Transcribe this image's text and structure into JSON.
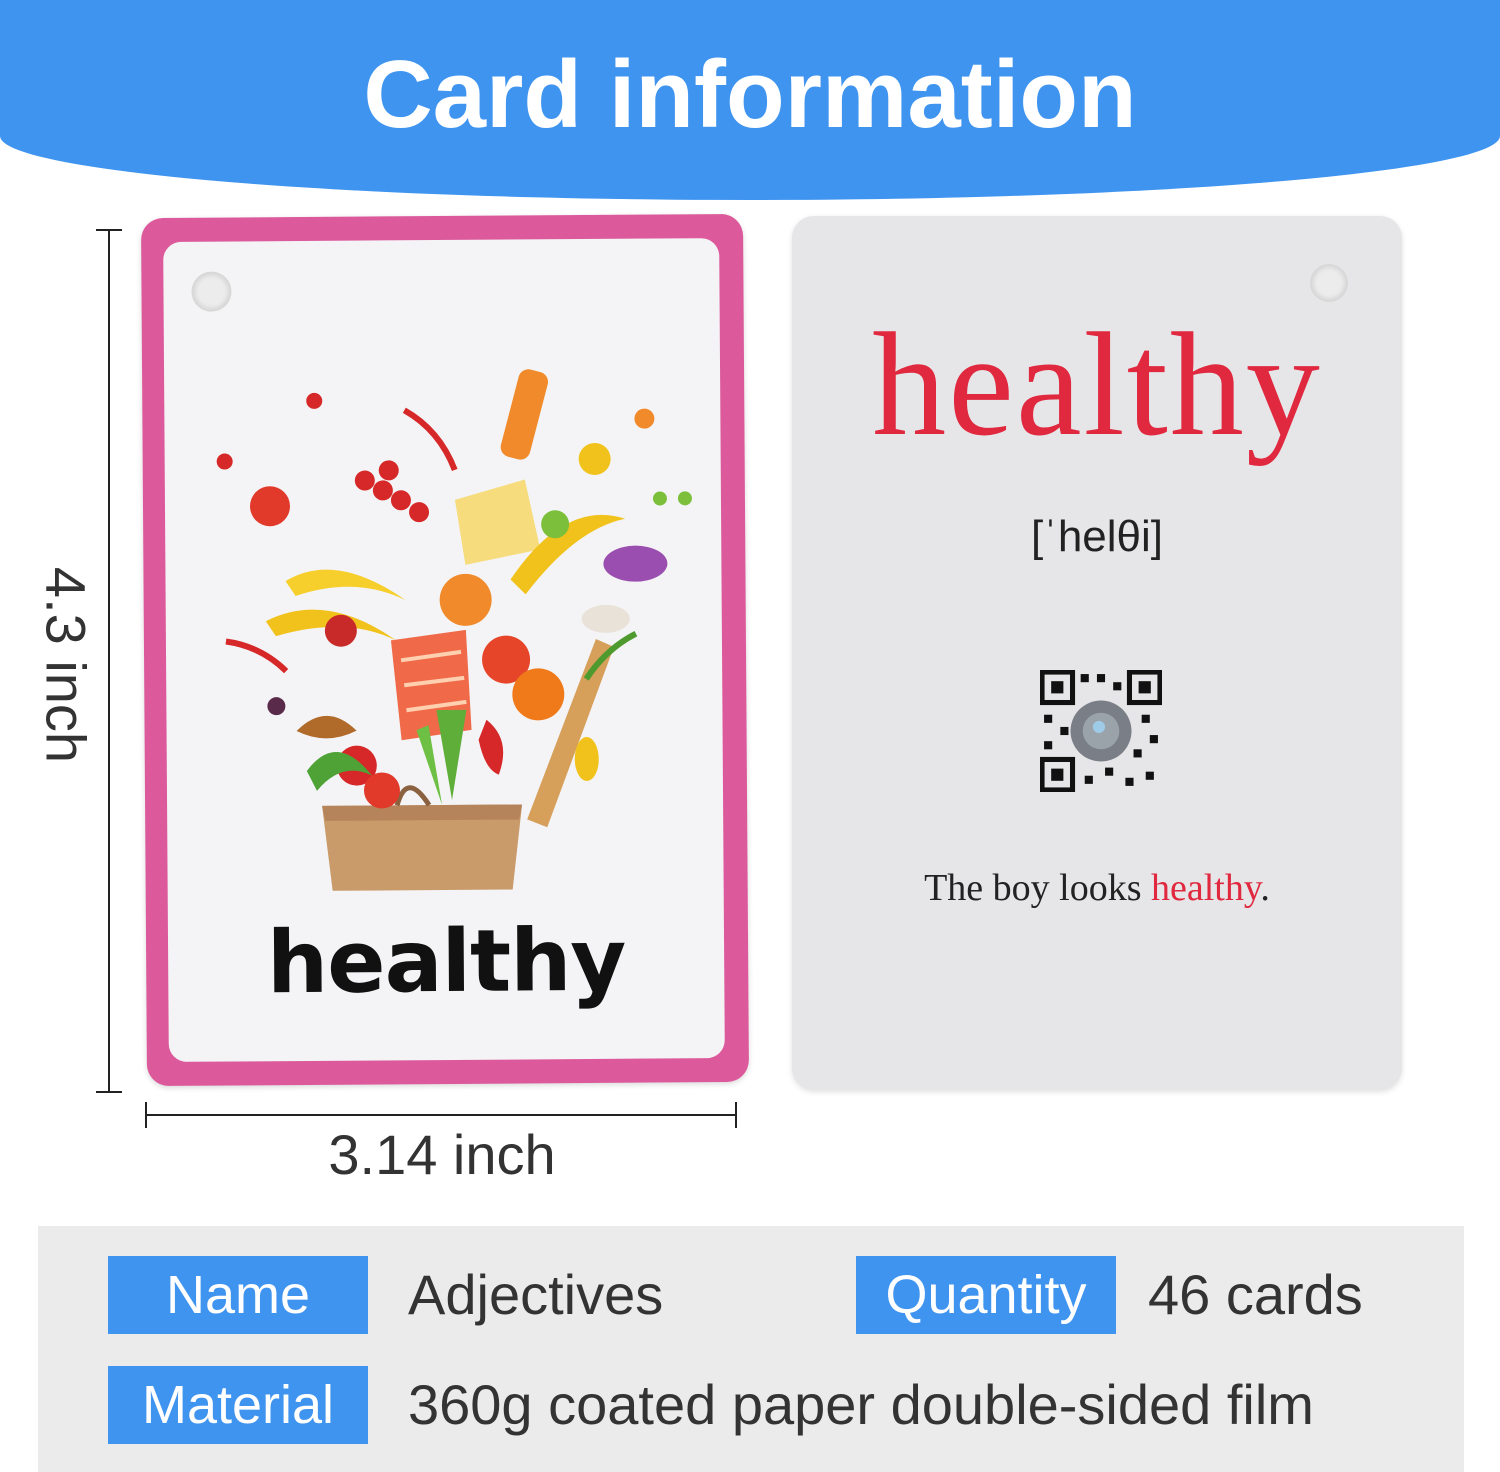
{
  "header": {
    "title": "Card information"
  },
  "dimensions": {
    "height_label": "4.3 inch",
    "width_label": "3.14 inch"
  },
  "front_card": {
    "word": "healthy",
    "border_color": "#dc5a9c",
    "illustration": "fruits-vegetables-grocery-bag"
  },
  "back_card": {
    "word": "healthy",
    "phonetic": "[ˈhelθi]",
    "qr": "qr-code-icon",
    "sentence_prefix": "The boy looks ",
    "sentence_highlight": "healthy",
    "sentence_suffix": ".",
    "accent_color": "#e0283f"
  },
  "info": {
    "name_label": "Name",
    "name_value": "Adjectives",
    "quantity_label": "Quantity",
    "quantity_value": "46 cards",
    "material_label": "Material",
    "material_value": "360g coated paper double-sided film",
    "tag_color": "#3f94f0"
  }
}
